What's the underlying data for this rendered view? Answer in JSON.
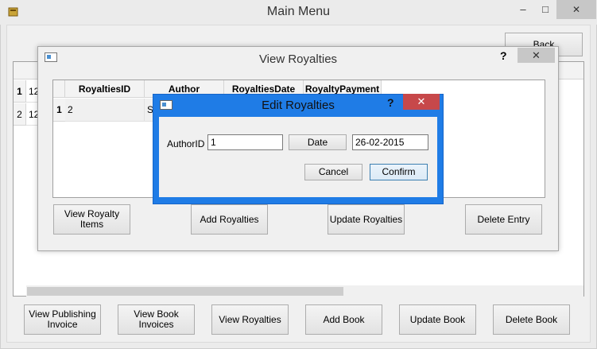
{
  "main": {
    "title": "Main Menu",
    "back_label": "Back",
    "rows": [
      {
        "header": "1",
        "cell": "12"
      },
      {
        "header": "2",
        "cell": "12"
      }
    ],
    "buttons": {
      "view_publishing_invoice": "View Publishing Invoice",
      "view_book_invoices": "View Book Invoices",
      "view_royalties": "View Royalties",
      "add_book": "Add Book",
      "update_book": "Update Book",
      "delete_book": "Delete Book"
    }
  },
  "view_royalties": {
    "title": "View Royalties",
    "help": "?",
    "columns": [
      "RoyaltiesID",
      "Author",
      "RoyaltiesDate",
      "RoyaltyPayment"
    ],
    "rows": [
      {
        "header": "1",
        "royalties_id": "2",
        "author": "S"
      }
    ],
    "buttons": {
      "view_items": "View Royalty Items",
      "add": "Add Royalties",
      "update": "Update Royalties",
      "delete": "Delete Entry"
    }
  },
  "edit_royalties": {
    "title": "Edit Royalties",
    "help": "?",
    "author_id_label": "AuthorID",
    "author_id_value": "1",
    "date_button": "Date",
    "date_value": "26-02-2015",
    "cancel": "Cancel",
    "confirm": "Confirm"
  },
  "colors": {
    "active_border": "#1f7ce6",
    "close_active": "#c7484a",
    "close_inactive": "#c7c7c7"
  },
  "icons": {
    "minimize": "minimize-icon",
    "maximize": "maximize-icon",
    "close": "close-icon",
    "app": "app-icon",
    "window": "window-icon"
  }
}
